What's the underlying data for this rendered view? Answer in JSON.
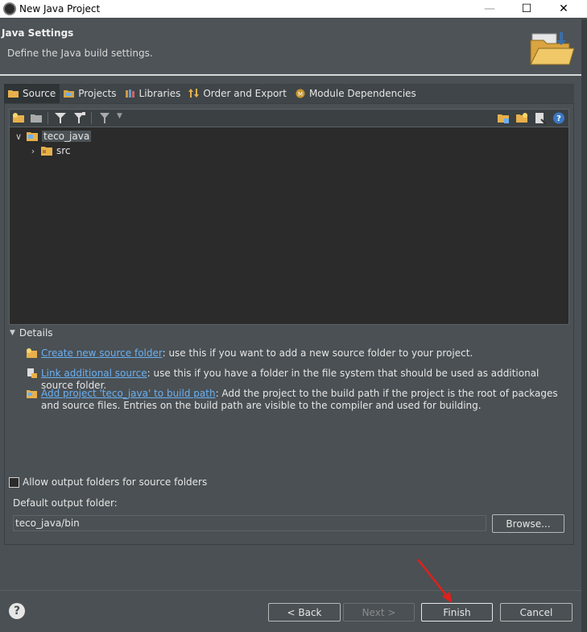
{
  "window": {
    "title": "New Java Project",
    "min": "—",
    "max": "☐",
    "close": "✕"
  },
  "header": {
    "title": "Java Settings",
    "subtitle": "Define the Java build settings."
  },
  "tabs": [
    {
      "label": "Source"
    },
    {
      "label": "Projects"
    },
    {
      "label": "Libraries"
    },
    {
      "label": "Order and Export"
    },
    {
      "label": "Module Dependencies"
    }
  ],
  "tree": {
    "root": {
      "label": "teco_java",
      "expanded": true
    },
    "child": {
      "label": "src",
      "expanded": false
    }
  },
  "details": {
    "toggle_label": "Details",
    "items": [
      {
        "link": "Create new source folder",
        "text": ": use this if you want to add a new source folder to your project."
      },
      {
        "link": "Link additional source",
        "text": ": use this if you have a folder in the file system that should be used as additional source folder."
      },
      {
        "link": "Add project 'teco_java' to build path",
        "text": ": Add the project to the build path if the project is the root of packages and source files. Entries on the build path are visible to the compiler and used for building."
      }
    ]
  },
  "output": {
    "allow_label": "Allow output folders for source folders",
    "allow_checked": false,
    "default_label": "Default output folder:",
    "default_value": "teco_java/bin",
    "browse_label": "Browse..."
  },
  "buttons": {
    "back": "< Back",
    "next": "Next >",
    "finish": "Finish",
    "cancel": "Cancel"
  },
  "help_glyph": "?",
  "icons": {
    "accent": "#6ab0f3",
    "folder": "#e8b04a"
  }
}
